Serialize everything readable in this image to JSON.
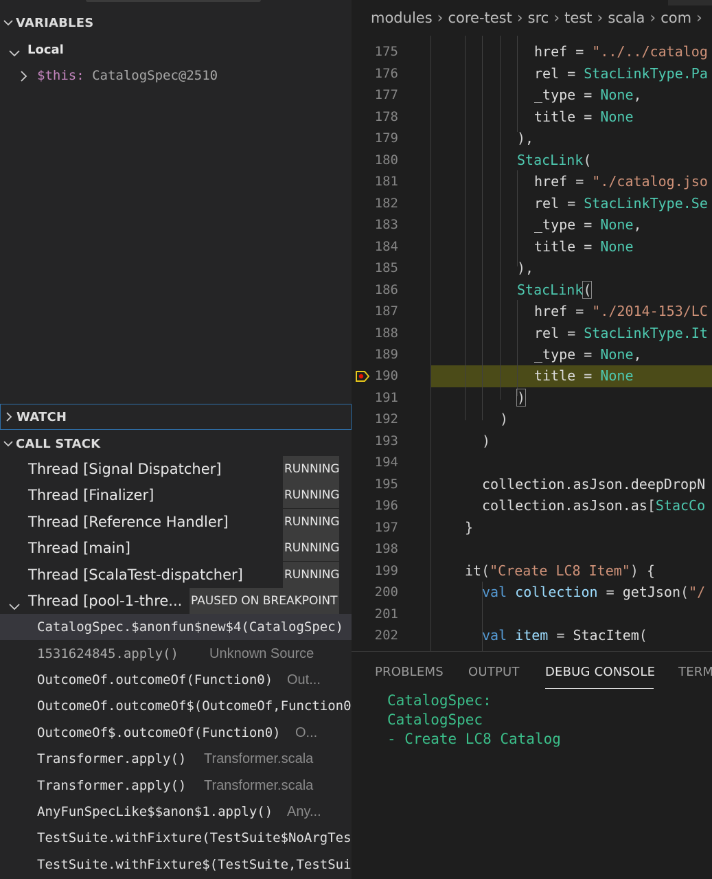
{
  "sidebar": {
    "variables_header": "VARIABLES",
    "local_header": "Local",
    "variable": {
      "name": "$this:",
      "value": "CatalogSpec@2510"
    },
    "watch_header": "WATCH",
    "call_stack_header": "CALL STACK",
    "threads": [
      {
        "name": "Thread [Signal Dispatcher]",
        "status": "RUNNING"
      },
      {
        "name": "Thread [Finalizer]",
        "status": "RUNNING"
      },
      {
        "name": "Thread [Reference Handler]",
        "status": "RUNNING"
      },
      {
        "name": "Thread [main]",
        "status": "RUNNING"
      },
      {
        "name": "Thread [ScalaTest-dispatcher]",
        "status": "RUNNING"
      },
      {
        "name": "Thread [pool-1-thre...",
        "status": "PAUSED ON BREAKPOINT"
      }
    ],
    "frames": [
      {
        "name": "CatalogSpec.$anonfun$new$4(CatalogSpec)",
        "source": ""
      },
      {
        "name": "1531624845.apply()",
        "source": "Unknown Source"
      },
      {
        "name": "OutcomeOf.outcomeOf(Function0)",
        "source": "Out..."
      },
      {
        "name": "OutcomeOf.outcomeOf$(OutcomeOf,Function0",
        "source": ""
      },
      {
        "name": "OutcomeOf$.outcomeOf(Function0)",
        "source": "O..."
      },
      {
        "name": "Transformer.apply()",
        "source": "Transformer.scala"
      },
      {
        "name": "Transformer.apply()",
        "source": "Transformer.scala"
      },
      {
        "name": "AnyFunSpecLike$$anon$1.apply()",
        "source": "Any..."
      },
      {
        "name": "TestSuite.withFixture(TestSuite$NoArgTes",
        "source": ""
      },
      {
        "name": "TestSuite.withFixture$(TestSuite,TestSui",
        "source": ""
      }
    ]
  },
  "editor": {
    "breadcrumb": [
      "modules",
      "core-test",
      "src",
      "test",
      "scala",
      "com"
    ],
    "breakpoint_line": "190",
    "lines": [
      {
        "n": "175",
        "code": "href = \"../../catalog"
      },
      {
        "n": "176",
        "code": "rel = StacLinkType.Pa"
      },
      {
        "n": "177",
        "code": "_type = None,"
      },
      {
        "n": "178",
        "code": "title = None"
      },
      {
        "n": "179",
        "code": "),"
      },
      {
        "n": "180",
        "code": "StacLink("
      },
      {
        "n": "181",
        "code": "href = \"./catalog.jso"
      },
      {
        "n": "182",
        "code": "rel = StacLinkType.Se"
      },
      {
        "n": "183",
        "code": "_type = None,"
      },
      {
        "n": "184",
        "code": "title = None"
      },
      {
        "n": "185",
        "code": "),"
      },
      {
        "n": "186",
        "code": "StacLink("
      },
      {
        "n": "187",
        "code": "href = \"./2014-153/LC"
      },
      {
        "n": "188",
        "code": "rel = StacLinkType.It"
      },
      {
        "n": "189",
        "code": "_type = None,"
      },
      {
        "n": "190",
        "code": "title = None"
      },
      {
        "n": "191",
        "code": ")"
      },
      {
        "n": "192",
        "code": ")"
      },
      {
        "n": "193",
        "code": ")"
      },
      {
        "n": "194",
        "code": ""
      },
      {
        "n": "195",
        "code": "collection.asJson.deepDropN"
      },
      {
        "n": "196",
        "code": "collection.asJson.as[StacCo"
      },
      {
        "n": "197",
        "code": "}"
      },
      {
        "n": "198",
        "code": ""
      },
      {
        "n": "199",
        "code": "it(\"Create LC8 Item\") {"
      },
      {
        "n": "200",
        "code": "val collection = getJson(\"/"
      },
      {
        "n": "201",
        "code": ""
      },
      {
        "n": "202",
        "code": "val item = StacItem("
      }
    ]
  },
  "panel": {
    "tabs": [
      "PROBLEMS",
      "OUTPUT",
      "DEBUG CONSOLE",
      "TERM"
    ],
    "active_tab": "DEBUG CONSOLE",
    "console": [
      "CatalogSpec:",
      "CatalogSpec",
      "- Create LC8 Catalog"
    ]
  },
  "colors": {
    "string": "#ce9178",
    "type": "#4ec9b0",
    "keyword": "#569cd6",
    "variable": "#9cdcfe",
    "console_text": "#3bbf8a",
    "breakpoint_highlight": "#4b4b18"
  }
}
